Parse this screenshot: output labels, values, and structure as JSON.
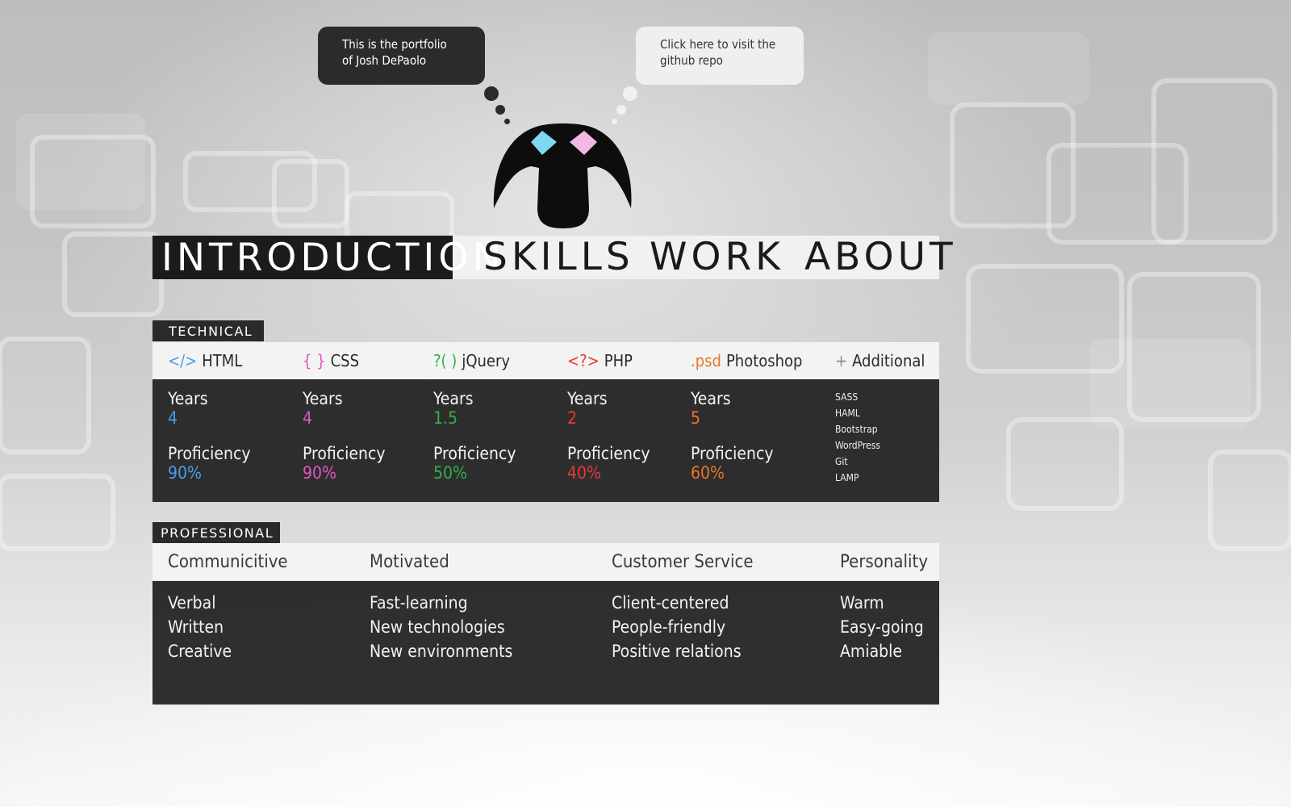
{
  "bubbles": {
    "intro": "This is the portfolio of Josh DePaolo",
    "github": "Click here to visit the github repo"
  },
  "logo": {
    "icon": "robot-logo-icon",
    "left_eye_color": "#7fd8f2",
    "right_eye_color": "#f2b8e6"
  },
  "nav": {
    "tabs": [
      "INTRODUCTION",
      "SKILLS",
      "WORK",
      "ABOUT"
    ],
    "active": "INTRODUCTION"
  },
  "technical": {
    "label": "TECHNICAL",
    "skills": [
      {
        "symbol": "</>",
        "name": "HTML",
        "color": "#4a9ee8",
        "years_label": "Years",
        "years": "4",
        "proficiency_label": "Proficiency",
        "proficiency": "90%"
      },
      {
        "symbol": "{ }",
        "name": "CSS",
        "color": "#e055c6",
        "years_label": "Years",
        "years": "4",
        "proficiency_label": "Proficiency",
        "proficiency": "90%"
      },
      {
        "symbol": "?( )",
        "name": "jQuery",
        "color": "#31b04c",
        "years_label": "Years",
        "years": "1.5",
        "proficiency_label": "Proficiency",
        "proficiency": "50%"
      },
      {
        "symbol": "<?>",
        "name": "PHP",
        "color": "#e53a3a",
        "years_label": "Years",
        "years": "2",
        "proficiency_label": "Proficiency",
        "proficiency": "40%"
      },
      {
        "symbol": ".psd",
        "name": "Photoshop",
        "color": "#e8742a",
        "years_label": "Years",
        "years": "5",
        "proficiency_label": "Proficiency",
        "proficiency": "60%"
      }
    ],
    "additional": {
      "symbol": "+",
      "name": "Additional",
      "items": [
        "SASS",
        "HAML",
        "Bootstrap",
        "WordPress",
        "Git",
        "LAMP"
      ]
    }
  },
  "professional": {
    "label": "PROFESSIONAL",
    "columns": [
      {
        "title": "Communicitive",
        "items": [
          "Verbal",
          "Written",
          "Creative"
        ]
      },
      {
        "title": "Motivated",
        "items": [
          "Fast-learning",
          "New technologies",
          "New environments"
        ]
      },
      {
        "title": "Customer Service",
        "items": [
          "Client-centered",
          "People-friendly",
          "Positive relations"
        ]
      },
      {
        "title": "Personality",
        "items": [
          "Warm",
          "Easy-going",
          "Amiable"
        ]
      }
    ]
  }
}
